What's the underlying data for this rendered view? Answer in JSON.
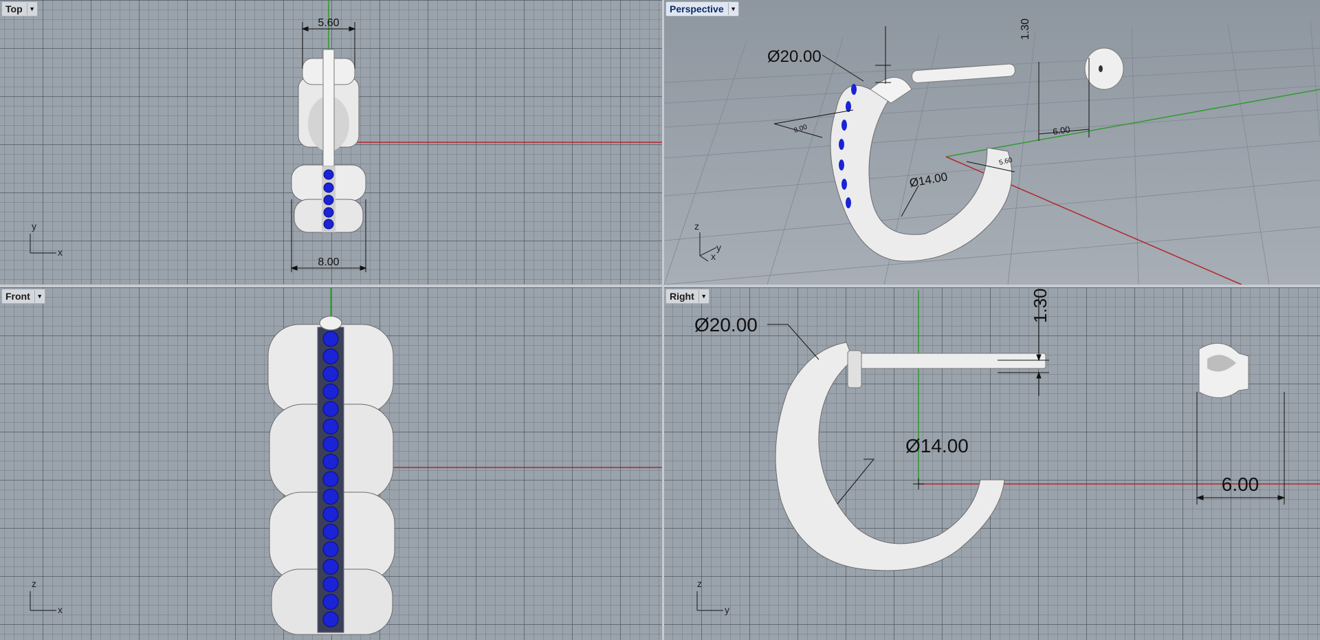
{
  "viewports": {
    "top": {
      "label": "Top"
    },
    "perspective": {
      "label": "Perspective"
    },
    "front": {
      "label": "Front"
    },
    "right": {
      "label": "Right"
    }
  },
  "dimensions": {
    "top_width_small": "5.60",
    "top_width_large": "8.00",
    "persp_outer_diameter": "Ø20.00",
    "persp_inner_diameter": "Ø14.00",
    "persp_post_diameter": "1.30",
    "persp_back_width": "6.00",
    "persp_small_a": "8.00",
    "persp_small_b": "5.60",
    "right_outer_diameter": "Ø20.00",
    "right_inner_diameter": "Ø14.00",
    "right_post_diameter": "1.30",
    "right_back_width": "6.00"
  },
  "axes": {
    "top": [
      "y",
      "x"
    ],
    "perspective": [
      "z",
      "y",
      "x"
    ],
    "front": [
      "z",
      "x"
    ],
    "right": [
      "z",
      "y"
    ]
  },
  "colors": {
    "grid_bg": "#9aa2ab",
    "x_axis": "#b3262a",
    "y_axis": "#2f9a2f",
    "stone": "#1a23d6",
    "metal": "#eeeeee"
  },
  "dropdown_icon": "triangle-down-icon"
}
